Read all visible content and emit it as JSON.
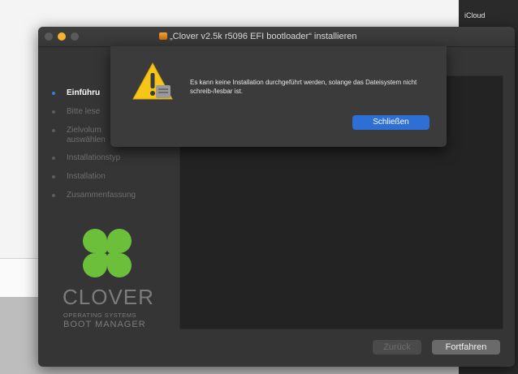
{
  "window": {
    "title": "„Clover v2.5k r5096 EFI bootloader“ installieren"
  },
  "side_panel": {
    "label": "iCloud"
  },
  "steps": [
    {
      "label": "Einführu",
      "state": "active"
    },
    {
      "label": "Bitte lese",
      "state": "inactive"
    },
    {
      "label": "Zielvolum",
      "state": "inactive"
    },
    {
      "label": "auswählen",
      "state": "inactive"
    },
    {
      "label": "Installationstyp",
      "state": "inactive"
    },
    {
      "label": "Installation",
      "state": "inactive"
    },
    {
      "label": "Zusammenfassung",
      "state": "inactive"
    }
  ],
  "branding": {
    "name": "CLOVER",
    "tagline_1": "OPERATING SYSTEMS",
    "tagline_2": "BOOT MANAGER",
    "icon": "four-leaf-clover-logo"
  },
  "dialog": {
    "icon": "warning-icon",
    "message": "Es kann keine Installation durchgeführt werden, solange das Dateisystem nicht schreib-/lesbar ist.",
    "close_label": "Schließen"
  },
  "buttons": {
    "back_label": "Zurück",
    "next_label": "Fortfahren"
  },
  "colors": {
    "accent": "#2e6fd6",
    "clover_green": "#6bbf3a",
    "warning_yellow": "#f5c518"
  }
}
